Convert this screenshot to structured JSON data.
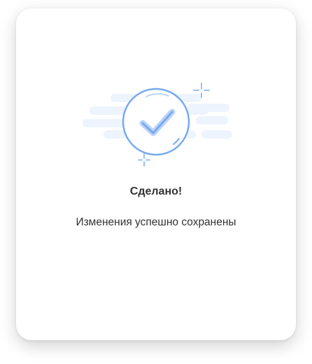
{
  "dialog": {
    "title": "Сделано!",
    "message": "Изменения успешно сохранены",
    "icon": "success-check-icon"
  },
  "colors": {
    "accent": "#7aaaf0",
    "cloud": "#eef4fd",
    "text": "#333333"
  }
}
